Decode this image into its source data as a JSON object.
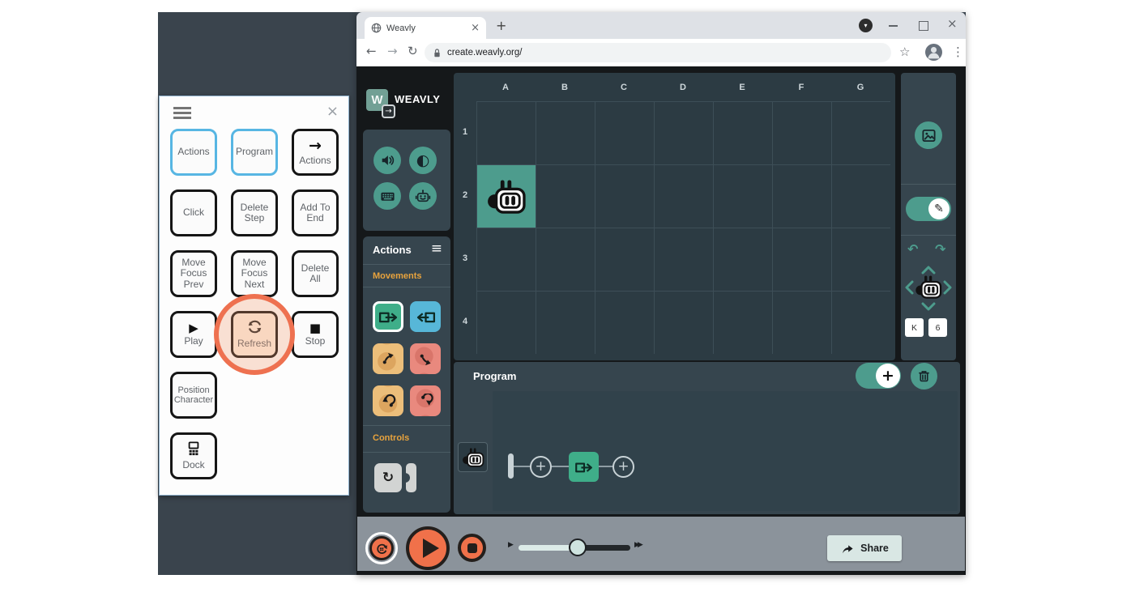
{
  "browser": {
    "tab_title": "Weavly",
    "url": "create.weavly.org/"
  },
  "icons": {
    "hamburger": "≡",
    "close": "×",
    "plus": "+",
    "star": "☆",
    "menu_dots": "⋮",
    "chevron_down": "▾",
    "back_arrow": "←",
    "forward_arrow": "→",
    "reload": "↻",
    "play": "▶",
    "stop": "■",
    "contrast": "◐",
    "pencil": "✎",
    "turn_ccw": "↶",
    "turn_cw": "↷",
    "loop": "↻",
    "slow": "▶",
    "fast": "▶▶",
    "arrow_right": "→",
    "w_mark": "W"
  },
  "overlay": {
    "buttons": [
      {
        "label": "Actions",
        "variant": "blue"
      },
      {
        "label": "Program",
        "variant": "blue"
      },
      {
        "label": "Actions",
        "variant": "black",
        "icon": "arrow-right"
      },
      {
        "label": "Click",
        "variant": "black"
      },
      {
        "label": "Delete Step",
        "variant": "black"
      },
      {
        "label": "Add To End",
        "variant": "black"
      },
      {
        "label": "Move Focus Prev",
        "variant": "black"
      },
      {
        "label": "Move Focus Next",
        "variant": "black"
      },
      {
        "label": "Delete All",
        "variant": "black"
      },
      {
        "label": "Play",
        "variant": "black",
        "icon": "play"
      },
      {
        "label": "Refresh",
        "variant": "black",
        "icon": "refresh",
        "highlighted": true
      },
      {
        "label": "Stop",
        "variant": "black",
        "icon": "stop"
      },
      {
        "label": "Position Character",
        "variant": "black"
      },
      {
        "label": "Dock",
        "variant": "black",
        "icon": "dock"
      }
    ]
  },
  "app": {
    "logo_text": "WEAVLY",
    "actions_panel": {
      "title": "Actions",
      "movements_label": "Movements",
      "controls_label": "Controls",
      "movement_blocks": [
        "move-forward (selected)",
        "move-backward",
        "turn-left-45",
        "turn-right-45",
        "turn-left-90",
        "turn-right-90"
      ],
      "control_blocks": [
        "loop"
      ]
    },
    "grid": {
      "columns": [
        "A",
        "B",
        "C",
        "D",
        "E",
        "F",
        "G"
      ],
      "rows": [
        "1",
        "2",
        "3",
        "4"
      ],
      "character_cell": "A2"
    },
    "character_controls": {
      "column_value": "K",
      "row_value": "6"
    },
    "program": {
      "title": "Program",
      "sequence": [
        "start",
        "add-node",
        "move-forward",
        "add-node"
      ]
    },
    "playback": {
      "speed_fraction": 0.5
    },
    "share_label": "Share"
  },
  "colors": {
    "teal": "#4d9c8d",
    "selected_green": "#3fae89",
    "blue_block": "#57b7d8",
    "orange_block": "#ecbe7a",
    "pink_block": "#e9897e",
    "highlight_ring": "#ee7150",
    "play_orange": "#f0714a",
    "panel_slate": "#36454e",
    "accent_label": "#e8a33d"
  }
}
